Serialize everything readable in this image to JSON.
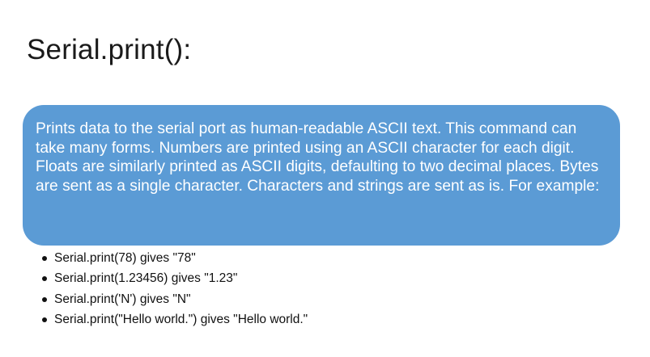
{
  "slide": {
    "title": "Serial.print():",
    "callout_text": "Prints data to the serial port as human-readable ASCII text. This command can take many forms. Numbers are printed using an ASCII character for each digit. Floats are similarly printed as ASCII digits, defaulting to two decimal places. Bytes are sent as a single character. Characters and strings are sent as is. For example:",
    "callout_color": "#5b9bd5",
    "examples": [
      "Serial.print(78) gives \"78\"",
      "Serial.print(1.23456) gives \"1.23\"",
      "Serial.print('N') gives \"N\"",
      "Serial.print(\"Hello world.\") gives \"Hello world.\""
    ]
  }
}
